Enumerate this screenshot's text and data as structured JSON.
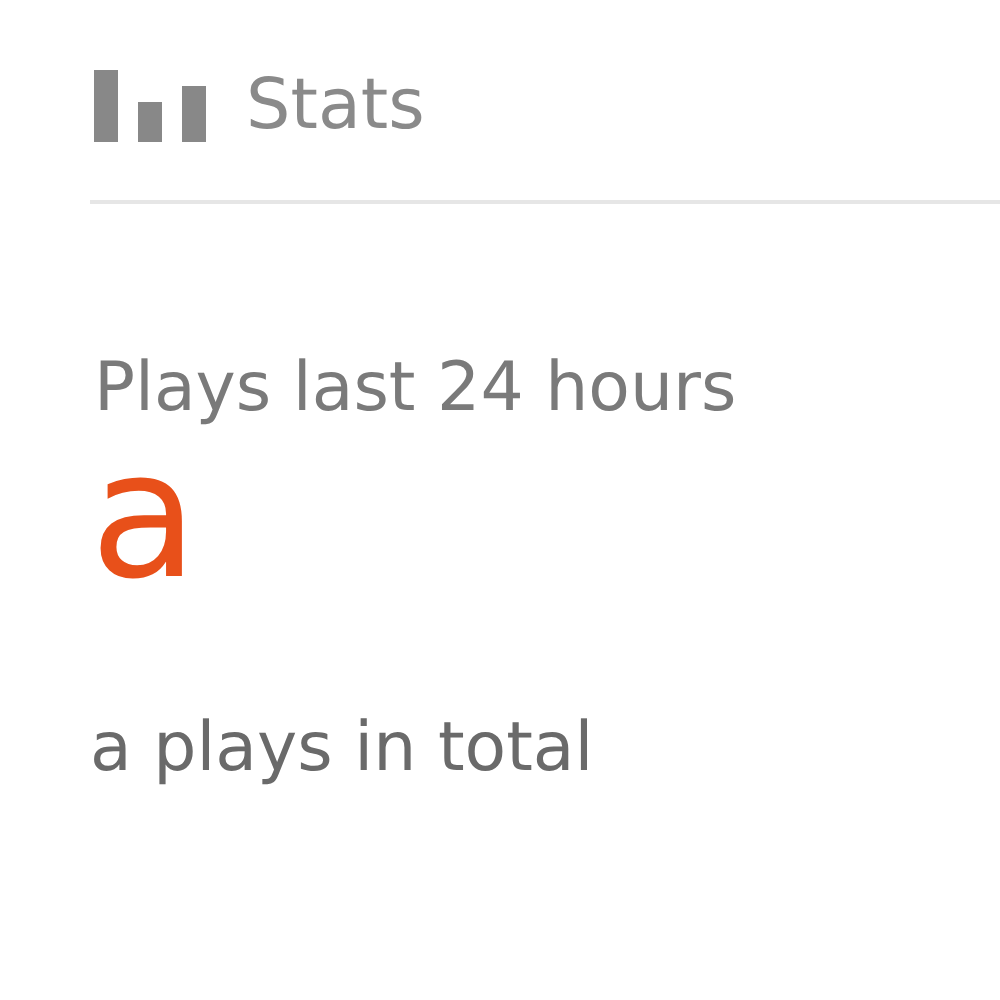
{
  "header": {
    "title": "Stats"
  },
  "stat": {
    "label": "Plays last 24 hours",
    "value": "a",
    "total": "a plays in total"
  }
}
